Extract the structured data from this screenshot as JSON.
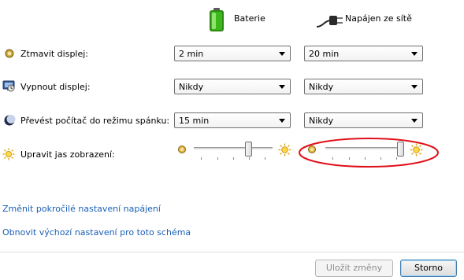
{
  "header": {
    "battery_label": "Baterie",
    "plugged_label": "Napájen ze sítě",
    "battery_icon": "battery-icon",
    "plugged_icon": "power-plug-icon"
  },
  "rows": {
    "dim": {
      "label": "Ztmavit displej:",
      "icon": "dim-display-icon",
      "battery": "2 min",
      "plugged": "20 min"
    },
    "off": {
      "label": "Vypnout displej:",
      "icon": "display-off-icon",
      "battery": "Nikdy",
      "plugged": "Nikdy"
    },
    "sleep": {
      "label": "Převést počítač do režimu spánku:",
      "icon": "sleep-icon",
      "battery": "15 min",
      "plugged": "Nikdy"
    },
    "brightness": {
      "label": "Upravit jas zobrazení:",
      "icon": "brightness-icon",
      "battery_level": 0.71,
      "plugged_level": 1.0
    }
  },
  "links": {
    "advanced": "Změnit pokročilé nastavení napájení",
    "restore": "Obnovit výchozí nastavení pro toto schéma"
  },
  "buttons": {
    "save": "Uložit změny",
    "cancel": "Storno"
  },
  "colors": {
    "link": "#1a5fb4",
    "annotation": "#e0101a",
    "battery": "#3cb81e"
  }
}
